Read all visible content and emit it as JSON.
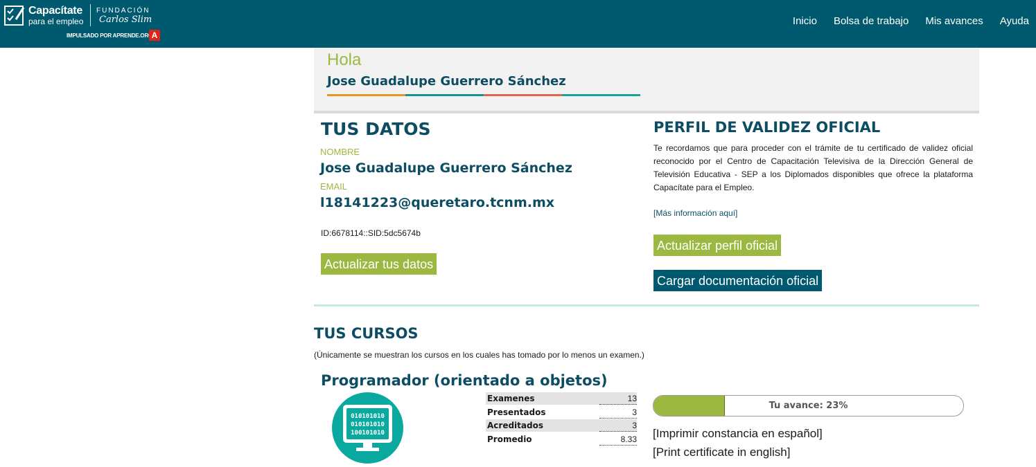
{
  "brand": {
    "logo_main": "Capacítate",
    "logo_sub": "para el empleo",
    "fundacion": "FUNDACIÓN",
    "carlos_slim": "Carlos Slim",
    "impulsado": "IMPULSADO POR APRENDE.ORG",
    "aprende_mark": "A"
  },
  "nav": {
    "items": [
      "Inicio",
      "Bolsa de trabajo",
      "Mis avances",
      "Ayuda"
    ]
  },
  "greeting": {
    "hello": "Hola",
    "name": "Jose Guadalupe Guerrero Sánchez",
    "bar_colors": [
      "#e8961e",
      "#15958a",
      "#e2664f",
      "#1aa394"
    ]
  },
  "datos": {
    "title": "TUS DATOS",
    "name_label": "NOMBRE",
    "name_value": "Jose Guadalupe Guerrero Sánchez",
    "email_label": "EMAIL",
    "email_value": "l18141223@queretaro.tcnm.mx",
    "id_text": "ID:6678114::SID:5dc5674b",
    "update_button": "Actualizar tus datos"
  },
  "perfil": {
    "title": "PERFIL DE VALIDEZ OFICIAL",
    "paragraph": "Te recordamos que para proceder con el trámite de tu certificado de validez oficial reconocido por el Centro de Capacitación Televisiva de la Dirección General de Televisión Educativa - SEP a los Diplomados disponibles que ofrece la plataforma Capacítate para el Empleo.",
    "more_info": "[Más información aquí]",
    "update_button": "Actualizar perfil oficial",
    "upload_button": "Cargar documentación oficial"
  },
  "cursos": {
    "title": "TUS CURSOS",
    "note": "(Únicamente se muestran los cursos en los cuales has tomado por lo menos un examen.)",
    "course": {
      "name": "Programador (orientado a objetos)",
      "icon_lines": [
        "010101010",
        "010101010",
        "100101010"
      ],
      "stats": [
        {
          "label": "Examenes",
          "value": "13"
        },
        {
          "label": "Presentados",
          "value": "3"
        },
        {
          "label": "Acreditados",
          "value": "3"
        },
        {
          "label": "Promedio",
          "value": "8.33"
        }
      ],
      "progress_percent": 23,
      "progress_label": "Tu avance: 23%",
      "print_es": "[Imprimir constancia en español]",
      "print_en": "[Print certificate in english]"
    }
  },
  "colors": {
    "header_bg": "#005a6f",
    "accent_green": "#9cb840",
    "title_blue": "#0c4d63",
    "icon_teal": "#0aa9a0"
  }
}
